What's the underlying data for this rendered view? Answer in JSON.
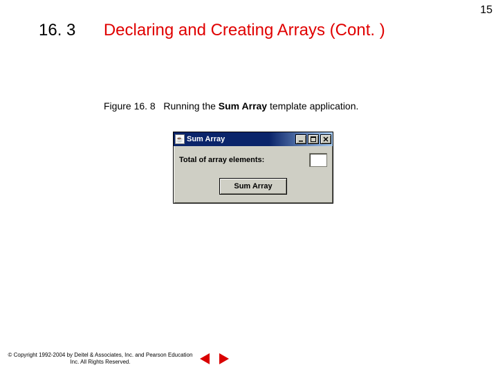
{
  "page_number": "15",
  "section_number": "16. 3",
  "section_title": "Declaring and Creating Arrays (Cont. )",
  "figure": {
    "label": "Figure 16. 8",
    "caption_prefix": "Running the ",
    "caption_bold": "Sum Array",
    "caption_suffix": " template application."
  },
  "app": {
    "title": "Sum Array",
    "label": "Total of array elements:",
    "result": "",
    "button_label": "Sum Array"
  },
  "footer": {
    "copyright": "© Copyright 1992-2004 by Deitel & Associates, Inc. and Pearson Education Inc. All Rights Reserved."
  }
}
